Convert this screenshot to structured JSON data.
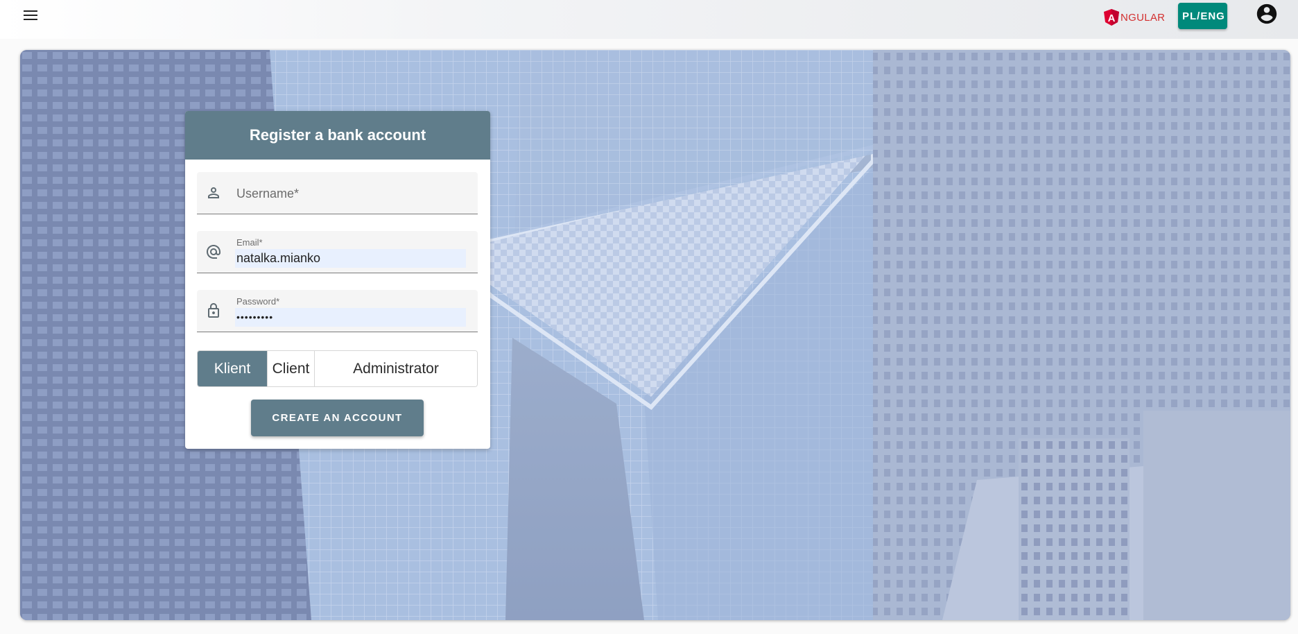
{
  "toolbar": {
    "brand_text": "NGULAR",
    "brand_letter": "A",
    "lang_label": "PL/ENG"
  },
  "card": {
    "title": "Register a bank account",
    "username": {
      "placeholder": "Username*",
      "value": ""
    },
    "email": {
      "label": "Email*",
      "value": "natalka.mianko"
    },
    "password": {
      "label": "Password*",
      "value": "•••••••••"
    },
    "roles": [
      {
        "label": "Klient",
        "selected": true
      },
      {
        "label": "Client",
        "selected": false
      },
      {
        "label": "Administrator",
        "selected": false
      }
    ],
    "submit_label": "CREATE AN ACCOUNT"
  },
  "colors": {
    "primary": "#607d8b",
    "lang_button": "#00897b",
    "brand": "#d32f2f",
    "autofill": "#e8f0fe"
  },
  "icons": {
    "menu": "menu-icon",
    "brand": "angular-logo",
    "account": "account-circle-icon",
    "username": "person-icon",
    "email": "at-sign-icon",
    "password": "lock-icon"
  }
}
